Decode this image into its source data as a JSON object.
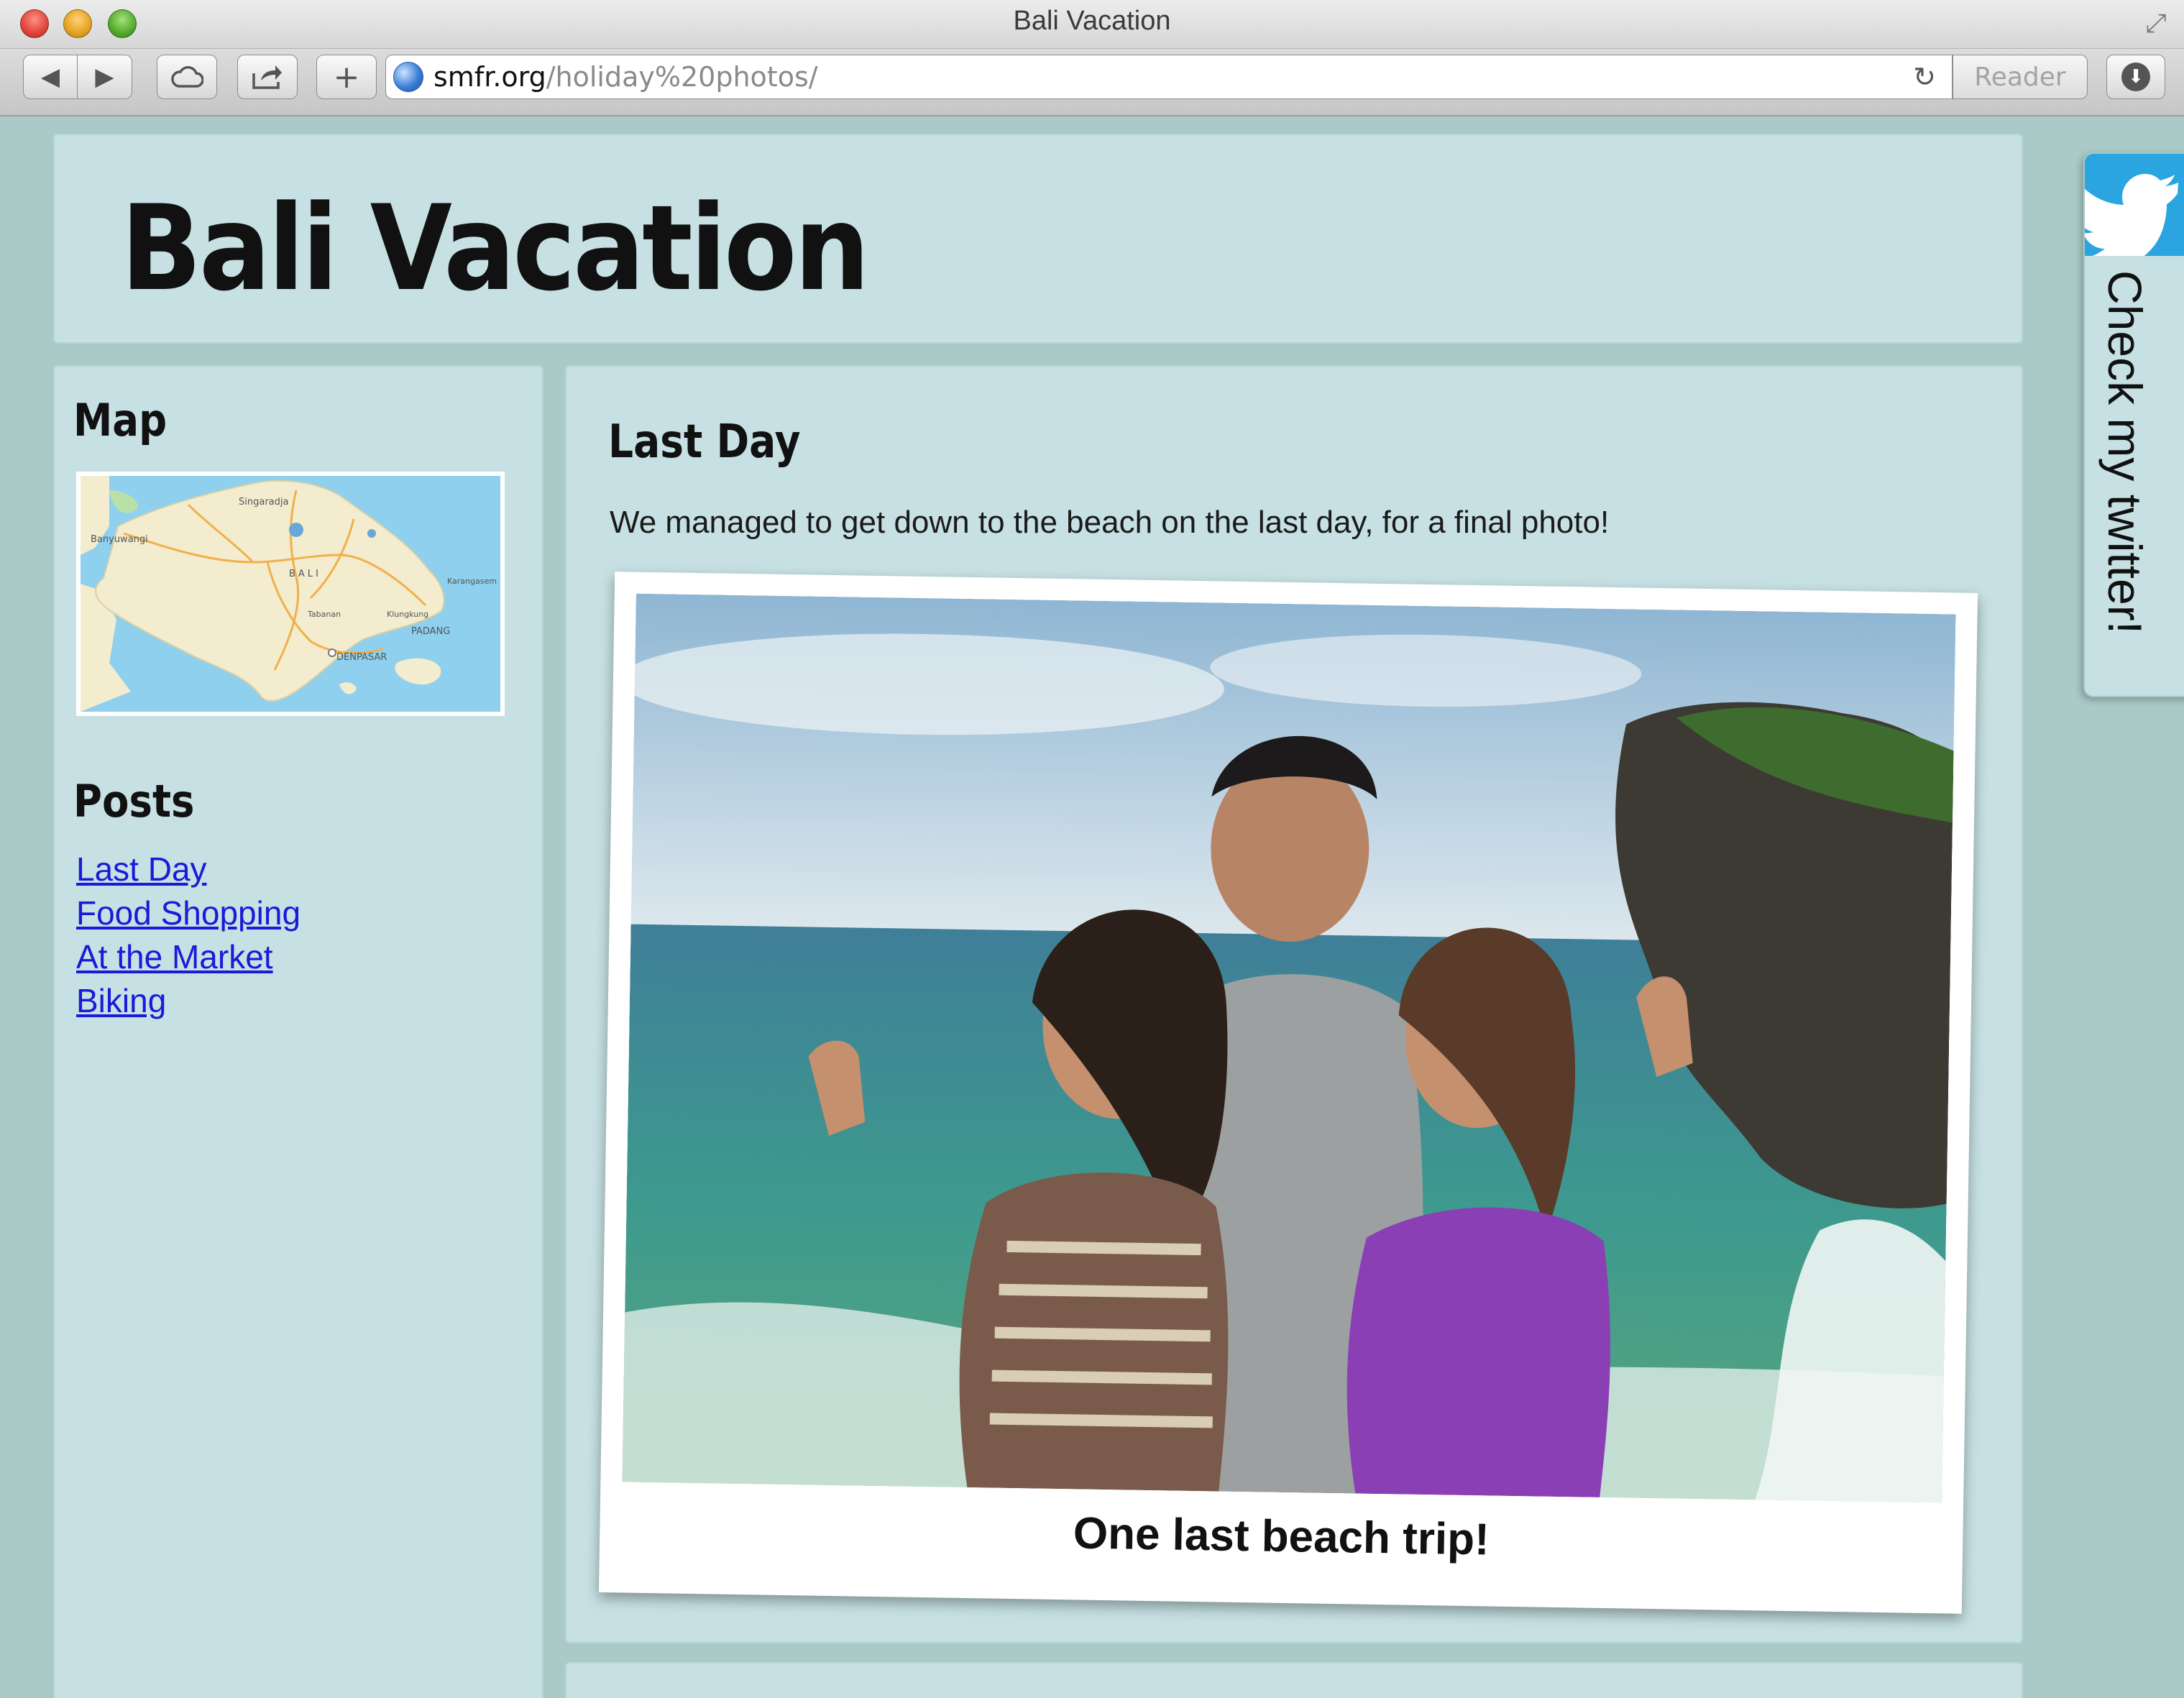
{
  "window": {
    "title": "Bali Vacation"
  },
  "toolbar": {
    "back_icon": "◀",
    "forward_icon": "▶",
    "newtab_label": "+",
    "url_domain": "smfr.org",
    "url_path": "/holiday%20photos/",
    "reload_icon": "↻",
    "reader_label": "Reader",
    "download_icon": "⬇"
  },
  "header": {
    "site_title": "Bali Vacation"
  },
  "sidebar": {
    "map_heading": "Map",
    "map_labels": {
      "singaradja": "Singaradja",
      "banyuwangi": "Banyuwangi",
      "bali": "BALI",
      "karangasem": "Karangasem",
      "tabanan": "Tabanan",
      "klungkung": "Klungkung",
      "padang": "PADANG",
      "denpasar": "DENPASAR"
    },
    "posts_heading": "Posts",
    "posts": [
      {
        "label": "Last Day"
      },
      {
        "label": "Food Shopping"
      },
      {
        "label": "At the Market"
      },
      {
        "label": "Biking"
      }
    ]
  },
  "post": {
    "title": "Last Day",
    "body": "We managed to get down to the beach on the last day, for a final photo!",
    "caption": "One last beach trip!"
  },
  "twitter": {
    "label": "Check my twitter!",
    "icon": "twitter-bird-icon"
  },
  "colors": {
    "page_bg": "#a9cac6",
    "panel_bg": "#c6e0e3",
    "link": "#1a1ad8",
    "twitter_blue": "#2aa5e0"
  }
}
